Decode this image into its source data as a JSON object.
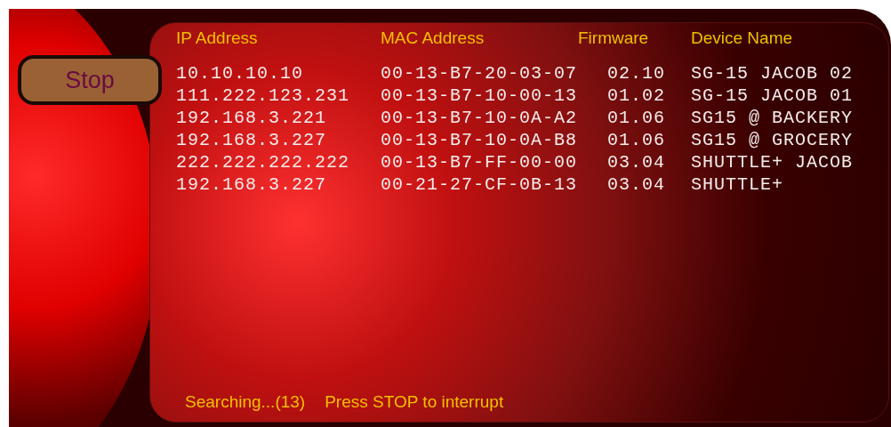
{
  "stop_button": {
    "label": "Stop"
  },
  "table": {
    "columns": [
      "IP Address",
      "MAC Address",
      "Firmware",
      "Device Name"
    ],
    "rows": [
      [
        "10.10.10.10",
        "00-13-B7-20-03-07",
        "02.10",
        "SG-15 JACOB 02"
      ],
      [
        "111.222.123.231",
        "00-13-B7-10-00-13",
        "01.02",
        "SG-15 JACOB 01"
      ],
      [
        "192.168.3.221",
        "00-13-B7-10-0A-A2",
        "01.06",
        "SG15 @ BACKERY"
      ],
      [
        "192.168.3.227",
        "00-13-B7-10-0A-B8",
        "01.06",
        "SG15 @ GROCERY"
      ],
      [
        "222.222.222.222",
        "00-13-B7-FF-00-00",
        "03.04",
        "SHUTTLE+ JACOB"
      ],
      [
        "192.168.3.227",
        "00-21-27-CF-0B-13",
        "03.04",
        "SHUTTLE+"
      ]
    ]
  },
  "status_bar": {
    "progress": "Searching...(13)",
    "hint": "Press STOP to interrupt"
  }
}
